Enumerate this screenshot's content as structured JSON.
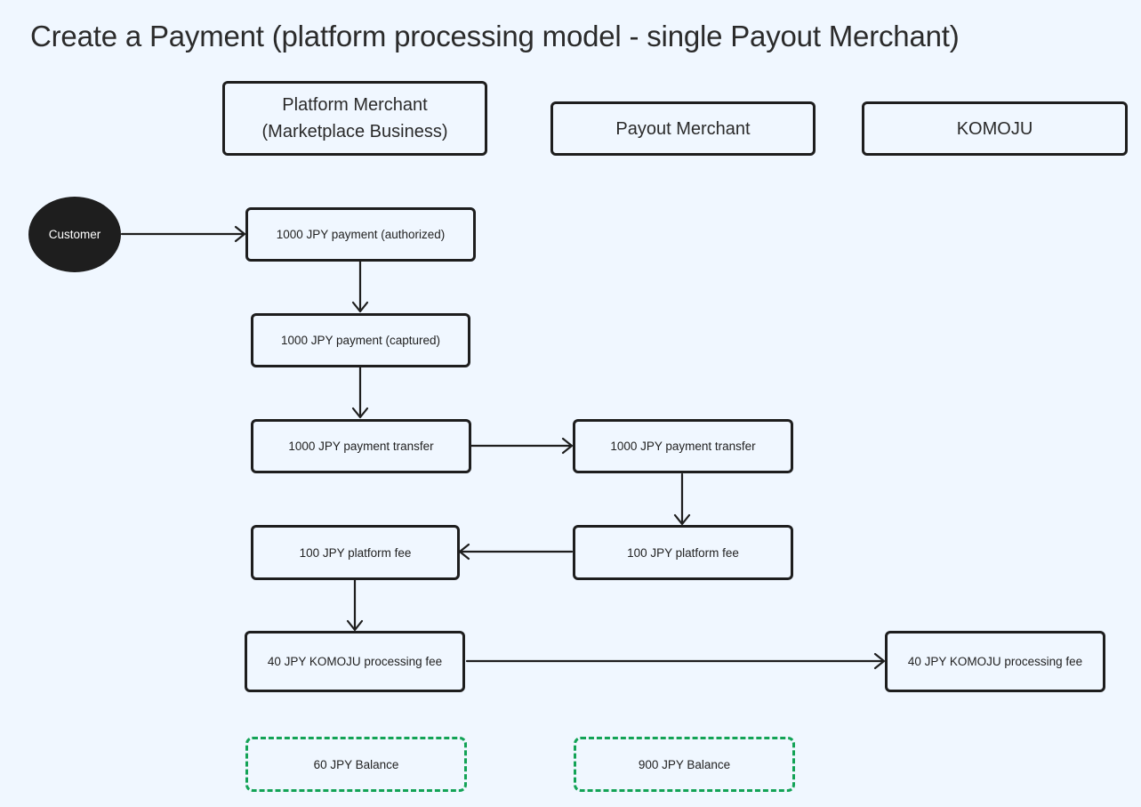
{
  "title": "Create a Payment (platform processing model - single Payout Merchant)",
  "lanes": {
    "platform_merchant": [
      "Platform Merchant",
      "(Marketplace Business)"
    ],
    "payout_merchant": "Payout Merchant",
    "komoju": "KOMOJU"
  },
  "nodes": {
    "customer": "Customer",
    "pm_authorized": "1000 JPY payment (authorized)",
    "pm_captured": "1000 JPY payment (captured)",
    "pm_transfer": "1000 JPY payment transfer",
    "po_transfer": "1000 JPY payment transfer",
    "po_platform_fee": "100 JPY platform fee",
    "pm_platform_fee": "100 JPY platform fee",
    "pm_komoju_fee": "40 JPY KOMOJU processing fee",
    "komoju_fee": "40 JPY KOMOJU processing fee"
  },
  "balances": {
    "platform_merchant": "60 JPY Balance",
    "payout_merchant": "900 JPY Balance"
  },
  "colors": {
    "background": "#f0f7ff",
    "stroke": "#1e1e1e",
    "balance_border": "#13a356"
  }
}
